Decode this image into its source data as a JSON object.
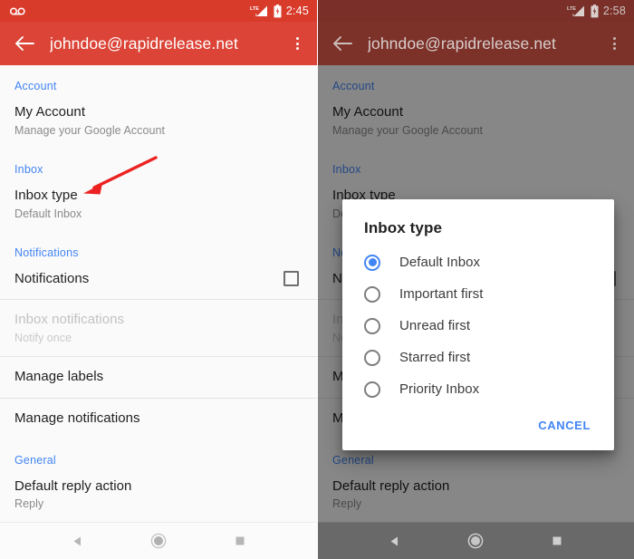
{
  "left_panel": {
    "status_bar": {
      "voicemail_icon": "voicemail-icon",
      "network_label": "LTE",
      "signal_icon": "signal-bars-icon",
      "battery_icon": "battery-charging-icon",
      "time": "2:45"
    },
    "app_bar": {
      "back_icon": "arrow-back-icon",
      "title": "johndoe@rapidrelease.net",
      "overflow_icon": "more-vert-icon"
    },
    "sections": [
      {
        "header": "Account",
        "rows": [
          {
            "title": "My Account",
            "subtitle": "Manage your Google Account",
            "disabled": false,
            "checkbox": false
          }
        ]
      },
      {
        "header": "Inbox",
        "rows": [
          {
            "title": "Inbox type",
            "subtitle": "Default Inbox",
            "disabled": false,
            "checkbox": false
          }
        ]
      },
      {
        "header": "Notifications",
        "rows": [
          {
            "title": "Notifications",
            "subtitle": "",
            "disabled": false,
            "checkbox": true,
            "checked": false
          },
          {
            "title": "Inbox notifications",
            "subtitle": "Notify once",
            "disabled": true,
            "checkbox": false
          },
          {
            "title": "Manage labels",
            "subtitle": "",
            "disabled": false,
            "checkbox": false
          },
          {
            "title": "Manage notifications",
            "subtitle": "",
            "disabled": false,
            "checkbox": false
          }
        ]
      },
      {
        "header": "General",
        "rows": [
          {
            "title": "Default reply action",
            "subtitle": "Reply",
            "disabled": false,
            "checkbox": false
          }
        ]
      }
    ],
    "nav_bar": {
      "back_icon": "nav-back-triangle-icon",
      "home_icon": "nav-home-circle-icon",
      "recents_icon": "nav-recents-square-icon"
    },
    "annotation": {
      "type": "arrow",
      "color": "#ec2222",
      "points_to": "Inbox type"
    }
  },
  "right_panel": {
    "status_bar": {
      "network_label": "LTE",
      "signal_icon": "signal-bars-icon",
      "battery_icon": "battery-charging-icon",
      "time": "2:58"
    },
    "app_bar": {
      "back_icon": "arrow-back-icon",
      "title": "johndoe@rapidrelease.net",
      "overflow_icon": "more-vert-icon"
    },
    "sections": [
      {
        "header": "Account",
        "rows": [
          {
            "title": "My Account",
            "subtitle": "Manage your Google Account",
            "disabled": false,
            "checkbox": false
          }
        ]
      },
      {
        "header": "Inbox",
        "rows": [
          {
            "title": "Inbox type",
            "subtitle": "Default Inbox",
            "disabled": false,
            "checkbox": false
          }
        ]
      },
      {
        "header": "Notifications",
        "rows": [
          {
            "title": "Notifications",
            "subtitle": "",
            "disabled": false,
            "checkbox": true,
            "checked": false
          },
          {
            "title": "Inbox notifications",
            "subtitle": "Notify once",
            "disabled": true,
            "checkbox": false
          },
          {
            "title": "Manage labels",
            "subtitle": "",
            "disabled": false,
            "checkbox": false
          },
          {
            "title": "Manage notifications",
            "subtitle": "",
            "disabled": false,
            "checkbox": false
          }
        ]
      },
      {
        "header": "General",
        "rows": [
          {
            "title": "Default reply action",
            "subtitle": "Reply",
            "disabled": false,
            "checkbox": false
          }
        ]
      }
    ],
    "dialog": {
      "title": "Inbox type",
      "options": [
        {
          "label": "Default Inbox",
          "selected": true
        },
        {
          "label": "Important first",
          "selected": false
        },
        {
          "label": "Unread first",
          "selected": false
        },
        {
          "label": "Starred first",
          "selected": false
        },
        {
          "label": "Priority Inbox",
          "selected": false
        }
      ],
      "cancel_label": "CANCEL"
    },
    "nav_bar": {
      "back_icon": "nav-back-triangle-icon",
      "home_icon": "nav-home-circle-icon",
      "recents_icon": "nav-recents-square-icon"
    }
  },
  "colors": {
    "app_bar": "#db4437",
    "status_bar": "#d93b2b",
    "accent_blue": "#4285f4",
    "annotation_red": "#ec2222",
    "scrim": "rgba(0,0,0,0.46)"
  }
}
